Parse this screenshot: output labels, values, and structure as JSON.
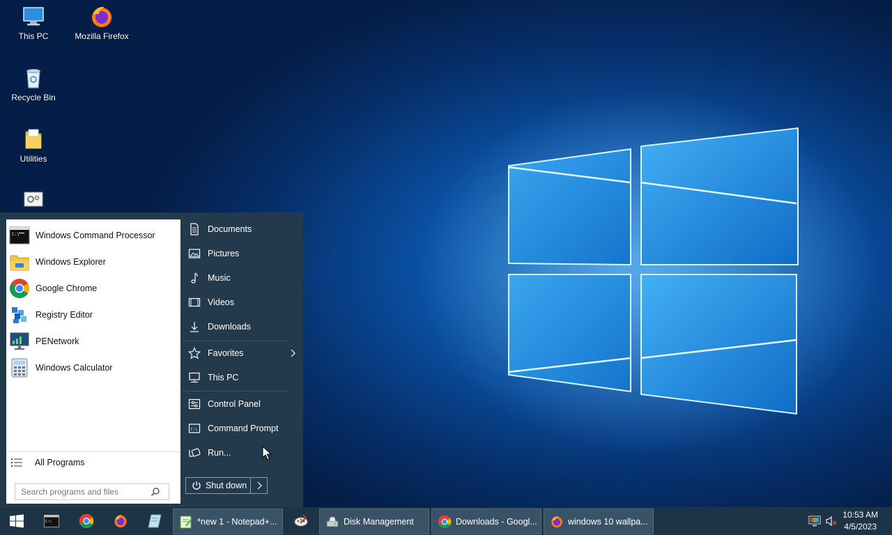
{
  "desktop": {
    "icons": [
      {
        "label": "This PC",
        "icon": "computer-icon"
      },
      {
        "label": "Mozilla Firefox",
        "icon": "firefox-icon"
      },
      {
        "label": "Recycle Bin",
        "icon": "recycle-bin-icon"
      },
      {
        "label": "Utilities",
        "icon": "folder-icon"
      },
      {
        "label": "",
        "icon": "settings-app-icon"
      }
    ]
  },
  "start_menu": {
    "pinned": [
      {
        "label": "Windows Command Processor",
        "icon": "cmd-icon"
      },
      {
        "label": "Windows Explorer",
        "icon": "explorer-folder-icon"
      },
      {
        "label": "Google Chrome",
        "icon": "chrome-icon"
      },
      {
        "label": "Registry Editor",
        "icon": "registry-icon"
      },
      {
        "label": "PENetwork",
        "icon": "network-icon"
      },
      {
        "label": "Windows Calculator",
        "icon": "calculator-icon"
      }
    ],
    "all_programs": "All Programs",
    "search_placeholder": "Search programs and files",
    "right_items": [
      {
        "label": "Documents",
        "icon": "document-icon"
      },
      {
        "label": "Pictures",
        "icon": "picture-icon"
      },
      {
        "label": "Music",
        "icon": "music-icon"
      },
      {
        "label": "Videos",
        "icon": "video-icon"
      },
      {
        "label": "Downloads",
        "icon": "download-icon"
      },
      {
        "label": "Favorites",
        "icon": "star-icon"
      },
      {
        "label": "This PC",
        "icon": "computer-icon"
      },
      {
        "label": "Control Panel",
        "icon": "control-panel-icon"
      },
      {
        "label": "Command Prompt",
        "icon": "command-prompt-icon"
      },
      {
        "label": "Run...",
        "icon": "run-icon"
      }
    ],
    "shutdown_label": "Shut down"
  },
  "taskbar": {
    "windows": [
      {
        "label": "*new 1 - Notepad+...",
        "icon": "notepadpp-icon"
      },
      {
        "label": "Disk Management",
        "icon": "disk-management-icon"
      },
      {
        "label": "Downloads - Googl...",
        "icon": "chrome-icon"
      },
      {
        "label": "windows 10 wallpa...",
        "icon": "firefox-icon"
      }
    ],
    "time": "10:53 AM",
    "date": "4/5/2023"
  },
  "colors": {
    "start_menu_bg": "#233a4d",
    "taskbar_bg": "#1d3446",
    "active_window_bg": "#3a5265"
  }
}
